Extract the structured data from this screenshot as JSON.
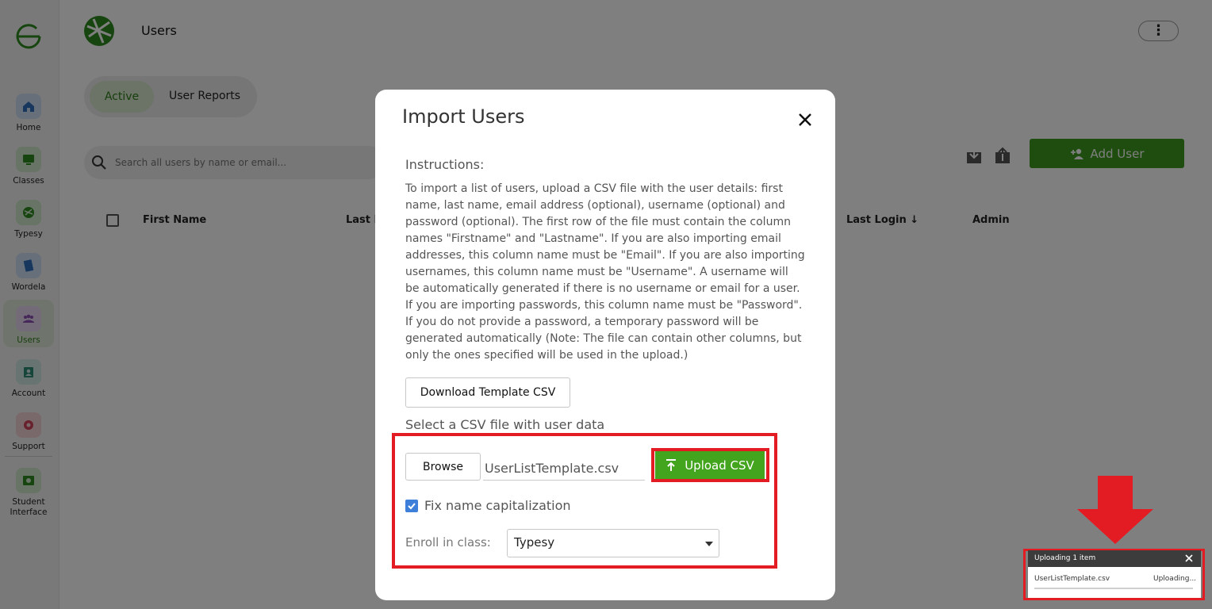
{
  "sidebar": {
    "items": [
      {
        "label": "Home",
        "icon": "home-icon"
      },
      {
        "label": "Classes",
        "icon": "classes-icon"
      },
      {
        "label": "Typesy",
        "icon": "typesy-icon"
      },
      {
        "label": "Wordela",
        "icon": "wordela-icon"
      },
      {
        "label": "Users",
        "icon": "users-icon"
      },
      {
        "label": "Account",
        "icon": "account-icon"
      },
      {
        "label": "Support",
        "icon": "support-icon"
      },
      {
        "label": "Student",
        "label2": "Interface",
        "icon": "student-interface-icon"
      }
    ]
  },
  "header": {
    "title": "Users"
  },
  "tabs": [
    {
      "label": "Active"
    },
    {
      "label": "User Reports"
    }
  ],
  "search": {
    "placeholder": "Search all users by name or email..."
  },
  "toolbar": {
    "add_user_label": "Add User"
  },
  "table": {
    "columns": [
      "First Name",
      "Last Name",
      "Last Login",
      "Admin"
    ],
    "visible_columns": {
      "first": "First Name",
      "last": "Last N",
      "login": "Last Login",
      "admin": "Admin"
    }
  },
  "modal": {
    "title": "Import Users",
    "instructions_heading": "Instructions:",
    "instructions_text": "To import a list of users, upload a CSV file with the user details: first name, last name, email address (optional), username (optional) and password (optional). The first row of the file must contain the column names \"Firstname\" and \"Lastname\". If you are also importing email addresses, this column name must be \"Email\". If you are also importing usernames, this column name must be \"Username\". A username will be automatically generated if there is no username or email for a user. If you are importing passwords, this column name must be \"Password\". If you do not provide a password, a temporary password will be generated automatically (Note: The file can contain other columns, but only the ones specified will be used in the upload.)",
    "download_template_label": "Download Template CSV",
    "select_file_label": "Select a CSV file with user data",
    "browse_label": "Browse",
    "file_name": "UserListTemplate.csv",
    "upload_label": "Upload CSV",
    "fix_capitalization_label": "Fix name capitalization",
    "fix_capitalization_checked": true,
    "enroll_label": "Enroll in class:",
    "enroll_value": "Typesy"
  },
  "upload_toast": {
    "title": "Uploading 1 item",
    "file_name": "UserListTemplate.csv",
    "status": "Uploading..."
  },
  "colors": {
    "brand_green": "#3d9a1e",
    "upload_green": "#43a41d",
    "highlight_red": "#e31b23",
    "checkbox_blue": "#3d7fd9",
    "overlay": "rgba(0,0,0,0.5)"
  }
}
